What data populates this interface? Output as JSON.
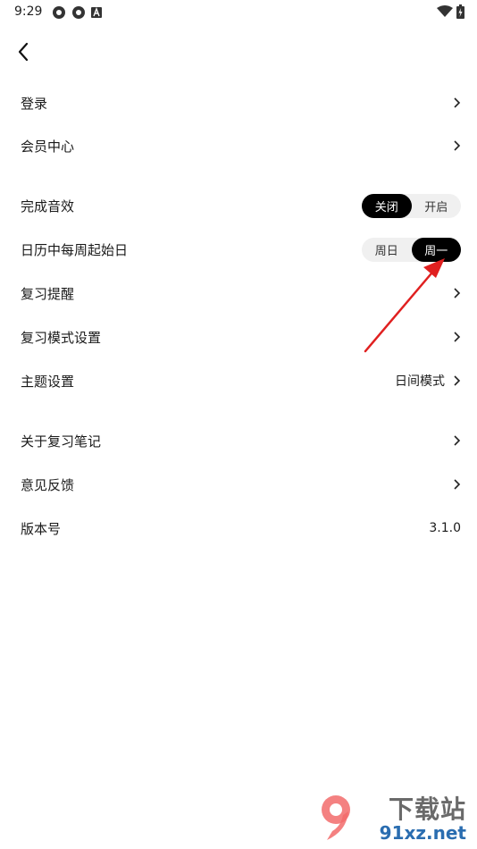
{
  "status_bar": {
    "time": "9:29",
    "left_icons": [
      "gear-icon",
      "gear-icon",
      "a-icon"
    ],
    "right_icons": [
      "wifi-icon",
      "battery-icon"
    ]
  },
  "nav": {
    "back_icon": "chevron-left-icon"
  },
  "rows": [
    {
      "label": "登录",
      "value": ""
    },
    {
      "label": "会员中心",
      "value": ""
    },
    {
      "label": "完成音效",
      "segmented": [
        "关闭",
        "开启"
      ],
      "selected": "关闭"
    },
    {
      "label": "日历中每周起始日",
      "segmented": [
        "周日",
        "周一"
      ],
      "selected": "周一"
    },
    {
      "label": "复习提醒",
      "value": ""
    },
    {
      "label": "复习模式设置",
      "value": ""
    },
    {
      "label": "主题设置",
      "value": "日间模式"
    },
    {
      "label": "关于复习笔记",
      "value": ""
    },
    {
      "label": "意见反馈",
      "value": ""
    },
    {
      "label": "版本号",
      "value": "3.1.0"
    }
  ],
  "annotation": {
    "color": "#e02020"
  },
  "watermark": {
    "top": "下载站",
    "bottom": "91xz.net",
    "logo": "9"
  }
}
